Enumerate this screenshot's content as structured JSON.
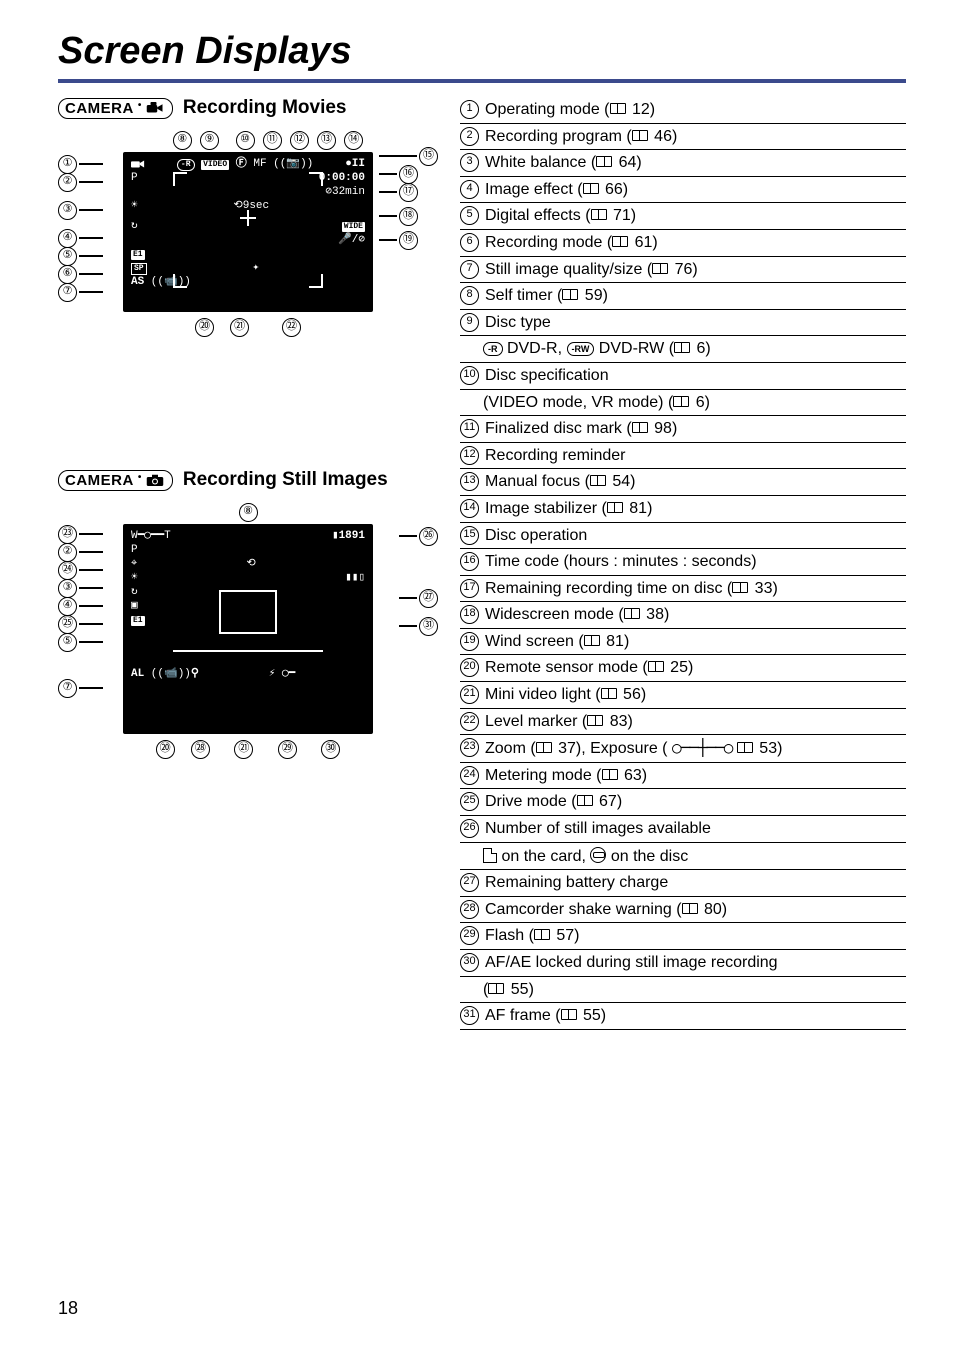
{
  "page": {
    "title": "Screen Displays",
    "number": "18"
  },
  "sections": {
    "movies": {
      "badge_text": "CAMERA",
      "heading": "Recording Movies",
      "top_callouts": [
        "⑧",
        "⑨",
        "⑩",
        "⑪",
        "⑫",
        "⑬",
        "⑭"
      ],
      "left_callouts": [
        "①",
        "②",
        "③",
        "④",
        "⑤",
        "⑥",
        "⑦"
      ],
      "right_callouts": [
        "⑮",
        "⑯",
        "⑰",
        "⑱",
        "⑲"
      ],
      "bottom_callouts": [
        "⑳",
        "㉑",
        "㉒"
      ],
      "osd": {
        "disc_badge": "-R",
        "video_badge": "VIDEO",
        "mf": "MF",
        "rec_pause": "●II",
        "timecode": "0:00:00",
        "remaining": "32min",
        "self_timer": "9sec",
        "wide": "WIDE",
        "p": "P",
        "e1": "E1",
        "sp": "SP",
        "as": "AS"
      }
    },
    "stills": {
      "badge_text": "CAMERA",
      "heading": "Recording Still Images",
      "top_callouts": [
        "⑧"
      ],
      "left_callouts": [
        "㉓",
        "②",
        "㉔",
        "③",
        "④",
        "㉕",
        "⑤",
        "⑦"
      ],
      "right_callouts": [
        "㉖",
        "㉗",
        "㉛"
      ],
      "bottom_callouts": [
        "⑳",
        "㉘",
        "㉑",
        "㉙",
        "㉚"
      ],
      "osd": {
        "count": "1891",
        "p": "P",
        "al": "AL"
      }
    }
  },
  "reference": [
    {
      "num": "1",
      "text_a": "Operating mode (",
      "page": "12",
      "text_b": ")"
    },
    {
      "num": "2",
      "text_a": "Recording program (",
      "page": "46",
      "text_b": ")"
    },
    {
      "num": "3",
      "text_a": "White balance (",
      "page": "64",
      "text_b": ")"
    },
    {
      "num": "4",
      "text_a": "Image effect (",
      "page": "66",
      "text_b": ")"
    },
    {
      "num": "5",
      "text_a": "Digital effects (",
      "page": "71",
      "text_b": ")"
    },
    {
      "num": "6",
      "text_a": "Recording mode (",
      "page": "61",
      "text_b": ")"
    },
    {
      "num": "7",
      "text_a": "Still image quality/size (",
      "page": "76",
      "text_b": ")"
    },
    {
      "num": "8",
      "text_a": "Self timer (",
      "page": "59",
      "text_b": ")"
    },
    {
      "num": "9",
      "text_a": "Disc type",
      "no_page": true,
      "sub_pre": "",
      "sub_discs": true,
      "sub_page": "6"
    },
    {
      "num": "10",
      "text_a": "Disc specification",
      "no_page": true,
      "sub_plain": "(VIDEO mode, VR mode) (",
      "sub_page": "6",
      "sub_after": ")"
    },
    {
      "num": "11",
      "text_a": "Finalized disc mark (",
      "page": "98",
      "text_b": ")"
    },
    {
      "num": "12",
      "text_a": "Recording reminder",
      "no_page": true
    },
    {
      "num": "13",
      "text_a": "Manual focus (",
      "page": "54",
      "text_b": ")"
    },
    {
      "num": "14",
      "text_a": "Image stabilizer (",
      "page": "81",
      "text_b": ")"
    },
    {
      "num": "15",
      "text_a": "Disc operation",
      "no_page": true
    },
    {
      "num": "16",
      "text_a": "Time code (hours : minutes : seconds)",
      "no_page": true
    },
    {
      "num": "17",
      "text_a": "Remaining recording time on disc (",
      "page": "33",
      "text_b": ")"
    },
    {
      "num": "18",
      "text_a": "Widescreen mode (",
      "page": "38",
      "text_b": ")"
    },
    {
      "num": "19",
      "text_a": "Wind screen (",
      "page": "81",
      "text_b": ")"
    },
    {
      "num": "20",
      "text_a": "Remote sensor mode (",
      "page": "25",
      "text_b": ")"
    },
    {
      "num": "21",
      "text_a": "Mini video light (",
      "page": "56",
      "text_b": ")"
    },
    {
      "num": "22",
      "text_a": "Level marker (",
      "page": "83",
      "text_b": ")"
    },
    {
      "num": "23",
      "text_a": "Zoom (",
      "page": "37",
      "text_b": "), Exposure ( ",
      "exposure": true,
      "page2": "53",
      "text_c": ")"
    },
    {
      "num": "24",
      "text_a": "Metering mode (",
      "page": "63",
      "text_b": ")"
    },
    {
      "num": "25",
      "text_a": "Drive mode (",
      "page": "67",
      "text_b": ")"
    },
    {
      "num": "26",
      "text_a": "Number of still images available",
      "no_page": true,
      "sub_storage": true
    },
    {
      "num": "27",
      "text_a": "Remaining battery charge",
      "no_page": true
    },
    {
      "num": "28",
      "text_a": "Camcorder shake warning (",
      "page": "80",
      "text_b": ")"
    },
    {
      "num": "29",
      "text_a": "Flash (",
      "page": "57",
      "text_b": ")"
    },
    {
      "num": "30",
      "text_a": "AF/AE locked during still image recording",
      "no_page": true,
      "sub_plain": "(",
      "sub_page": "55",
      "sub_after": ")"
    },
    {
      "num": "31",
      "text_a": "AF frame (",
      "page": "55",
      "text_b": ")"
    }
  ],
  "labels": {
    "dvd_r": "DVD-R,",
    "dvd_rw": "DVD-RW (",
    "on_card": " on the card, ",
    "on_disc": " on the disc",
    "disc_r_badge": "-R",
    "disc_rw_badge": "-RW"
  }
}
